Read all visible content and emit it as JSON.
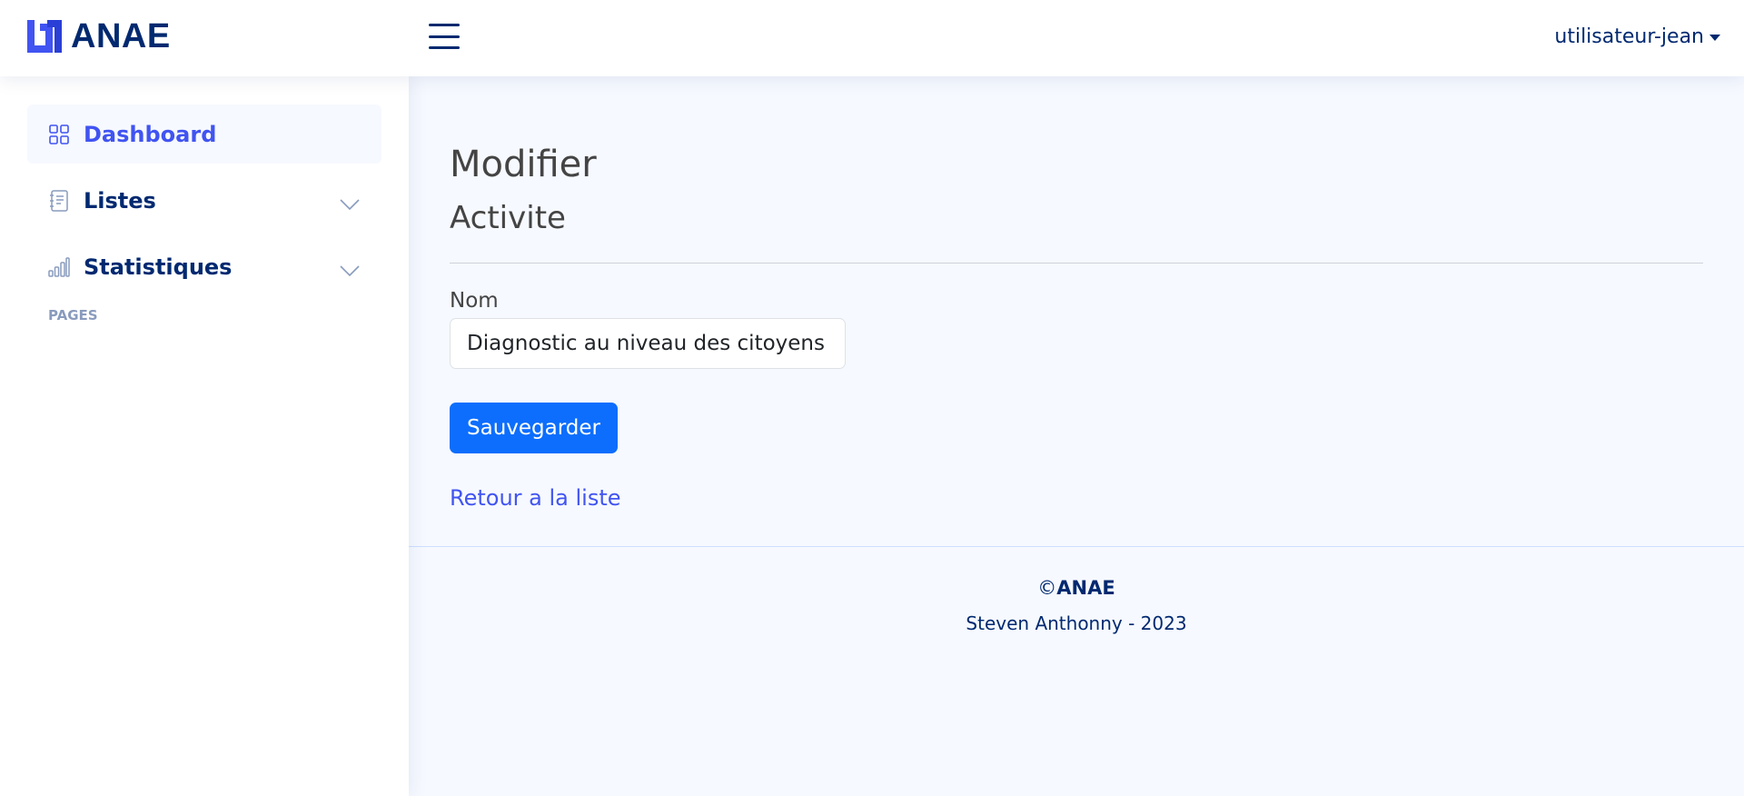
{
  "header": {
    "logo_text": "ANAE",
    "user_name": "utilisateur-jean"
  },
  "sidebar": {
    "items": [
      {
        "label": "Dashboard",
        "icon": "grid-icon",
        "active": true
      },
      {
        "label": "Listes",
        "icon": "journal-text-icon",
        "expandable": true
      },
      {
        "label": "Statistiques",
        "icon": "bar-chart-icon",
        "expandable": true
      }
    ],
    "heading": "Pages"
  },
  "main": {
    "title": "Modifier",
    "subtitle": "Activite",
    "form": {
      "nom_label": "Nom",
      "nom_value": "Diagnostic au niveau des citoyens",
      "save_label": "Sauvegarder"
    },
    "back_link": "Retour a la liste"
  },
  "footer": {
    "copyright_symbol": "©",
    "copyright_brand": "ANAE",
    "credits": "Steven Anthonny - 2023"
  },
  "colors": {
    "brand": "#012970",
    "accent": "#4154f1",
    "primary_button": "#0d6efd",
    "background": "#f6f9ff"
  }
}
